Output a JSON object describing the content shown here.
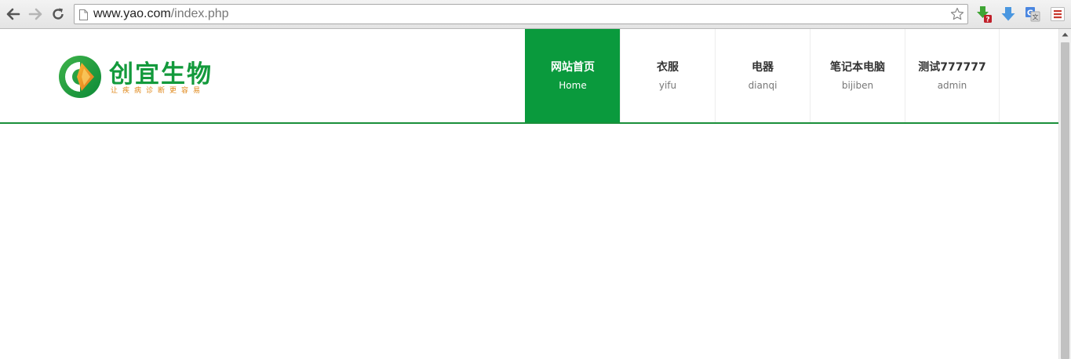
{
  "browser": {
    "url_domain": "www.yao.com",
    "url_path": "/index.php",
    "icons": {
      "back": "back-arrow-icon",
      "forward": "forward-arrow-icon",
      "reload": "reload-icon",
      "page": "page-icon",
      "bookmark": "star-icon",
      "extensions": [
        "download-extension-icon",
        "download-arrow-icon",
        "translate-icon",
        "menu-icon"
      ]
    },
    "ext_badge": "?"
  },
  "site": {
    "logo": {
      "title": "创宜生物",
      "subtitle": "让疾病诊断更容易",
      "colors": {
        "green": "#139a3c",
        "orange": "#e08a1e"
      }
    },
    "accent_color": "#0a9a3d",
    "nav": [
      {
        "cn": "网站首页",
        "en": "Home",
        "active": true
      },
      {
        "cn": "衣服",
        "en": "yifu",
        "active": false
      },
      {
        "cn": "电器",
        "en": "dianqi",
        "active": false
      },
      {
        "cn": "笔记本电脑",
        "en": "bijiben",
        "active": false
      },
      {
        "cn": "测试777777",
        "en": "admin",
        "active": false
      }
    ]
  }
}
